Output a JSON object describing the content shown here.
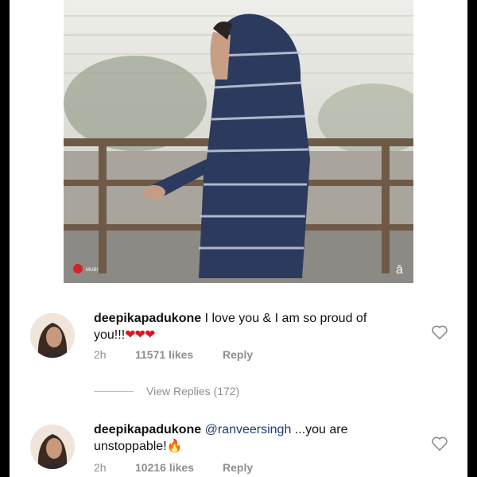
{
  "post": {
    "image_watermark": "ā",
    "image_badge": "MUBI"
  },
  "comments": [
    {
      "username": "deepikapadukone",
      "text_before": " I love you & I am so proud of you!!!",
      "emoji": "❤❤❤",
      "time": "2h",
      "likes": "11571 likes",
      "reply_label": "Reply"
    },
    {
      "username": "deepikapadukone",
      "mention": "@ranveersingh",
      "text_before": " ...you are unstoppable!",
      "emoji": "🔥",
      "time": "2h",
      "likes": "10216 likes",
      "reply_label": "Reply"
    }
  ],
  "view_replies": {
    "label": "View Replies (172)"
  },
  "icons": {
    "like": "heart-outline-icon"
  }
}
